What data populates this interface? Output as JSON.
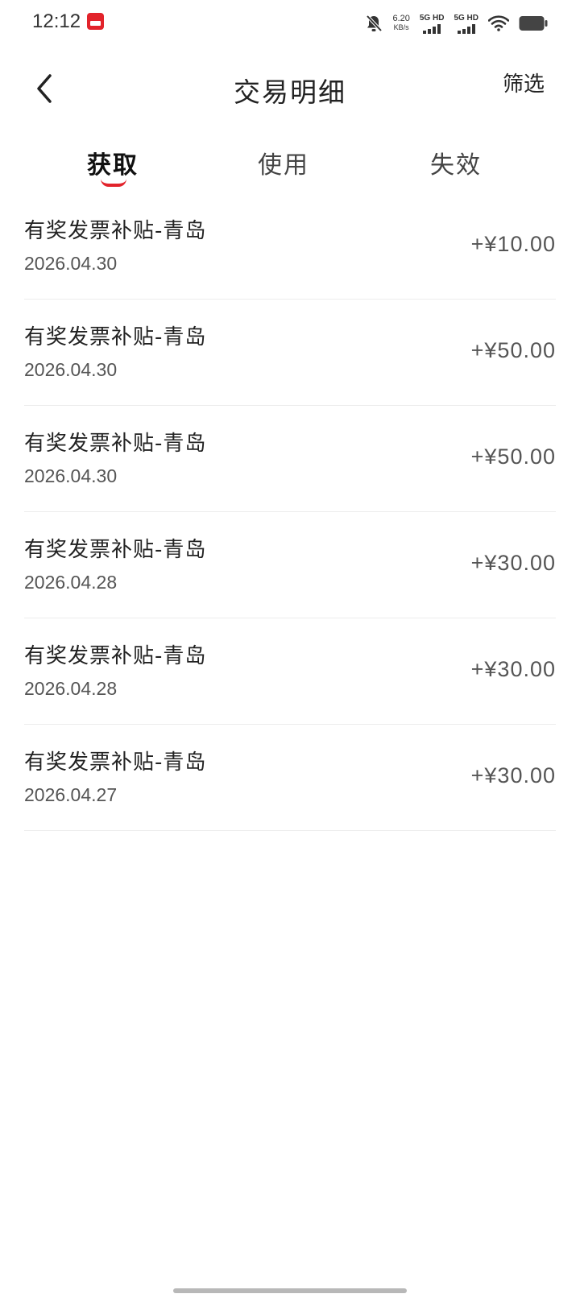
{
  "status_bar": {
    "time": "12:12",
    "net_speed_value": "6.20",
    "net_speed_unit": "KB/s",
    "sim1_label": "5G HD",
    "sim2_label": "5G HD",
    "battery_color": "#444444"
  },
  "header": {
    "back_icon": "chevron-left-icon",
    "title": "交易明细",
    "filter_label": "筛选"
  },
  "tabs": [
    {
      "label": "获取",
      "active": true
    },
    {
      "label": "使用",
      "active": false
    },
    {
      "label": "失效",
      "active": false
    }
  ],
  "accent_color": "#e2232b",
  "records": [
    {
      "title": "有奖发票补贴-青岛",
      "date": "2026.04.30",
      "amount": "+¥10.00"
    },
    {
      "title": "有奖发票补贴-青岛",
      "date": "2026.04.30",
      "amount": "+¥50.00"
    },
    {
      "title": "有奖发票补贴-青岛",
      "date": "2026.04.30",
      "amount": "+¥50.00"
    },
    {
      "title": "有奖发票补贴-青岛",
      "date": "2026.04.28",
      "amount": "+¥30.00"
    },
    {
      "title": "有奖发票补贴-青岛",
      "date": "2026.04.28",
      "amount": "+¥30.00"
    },
    {
      "title": "有奖发票补贴-青岛",
      "date": "2026.04.27",
      "amount": "+¥30.00"
    }
  ]
}
